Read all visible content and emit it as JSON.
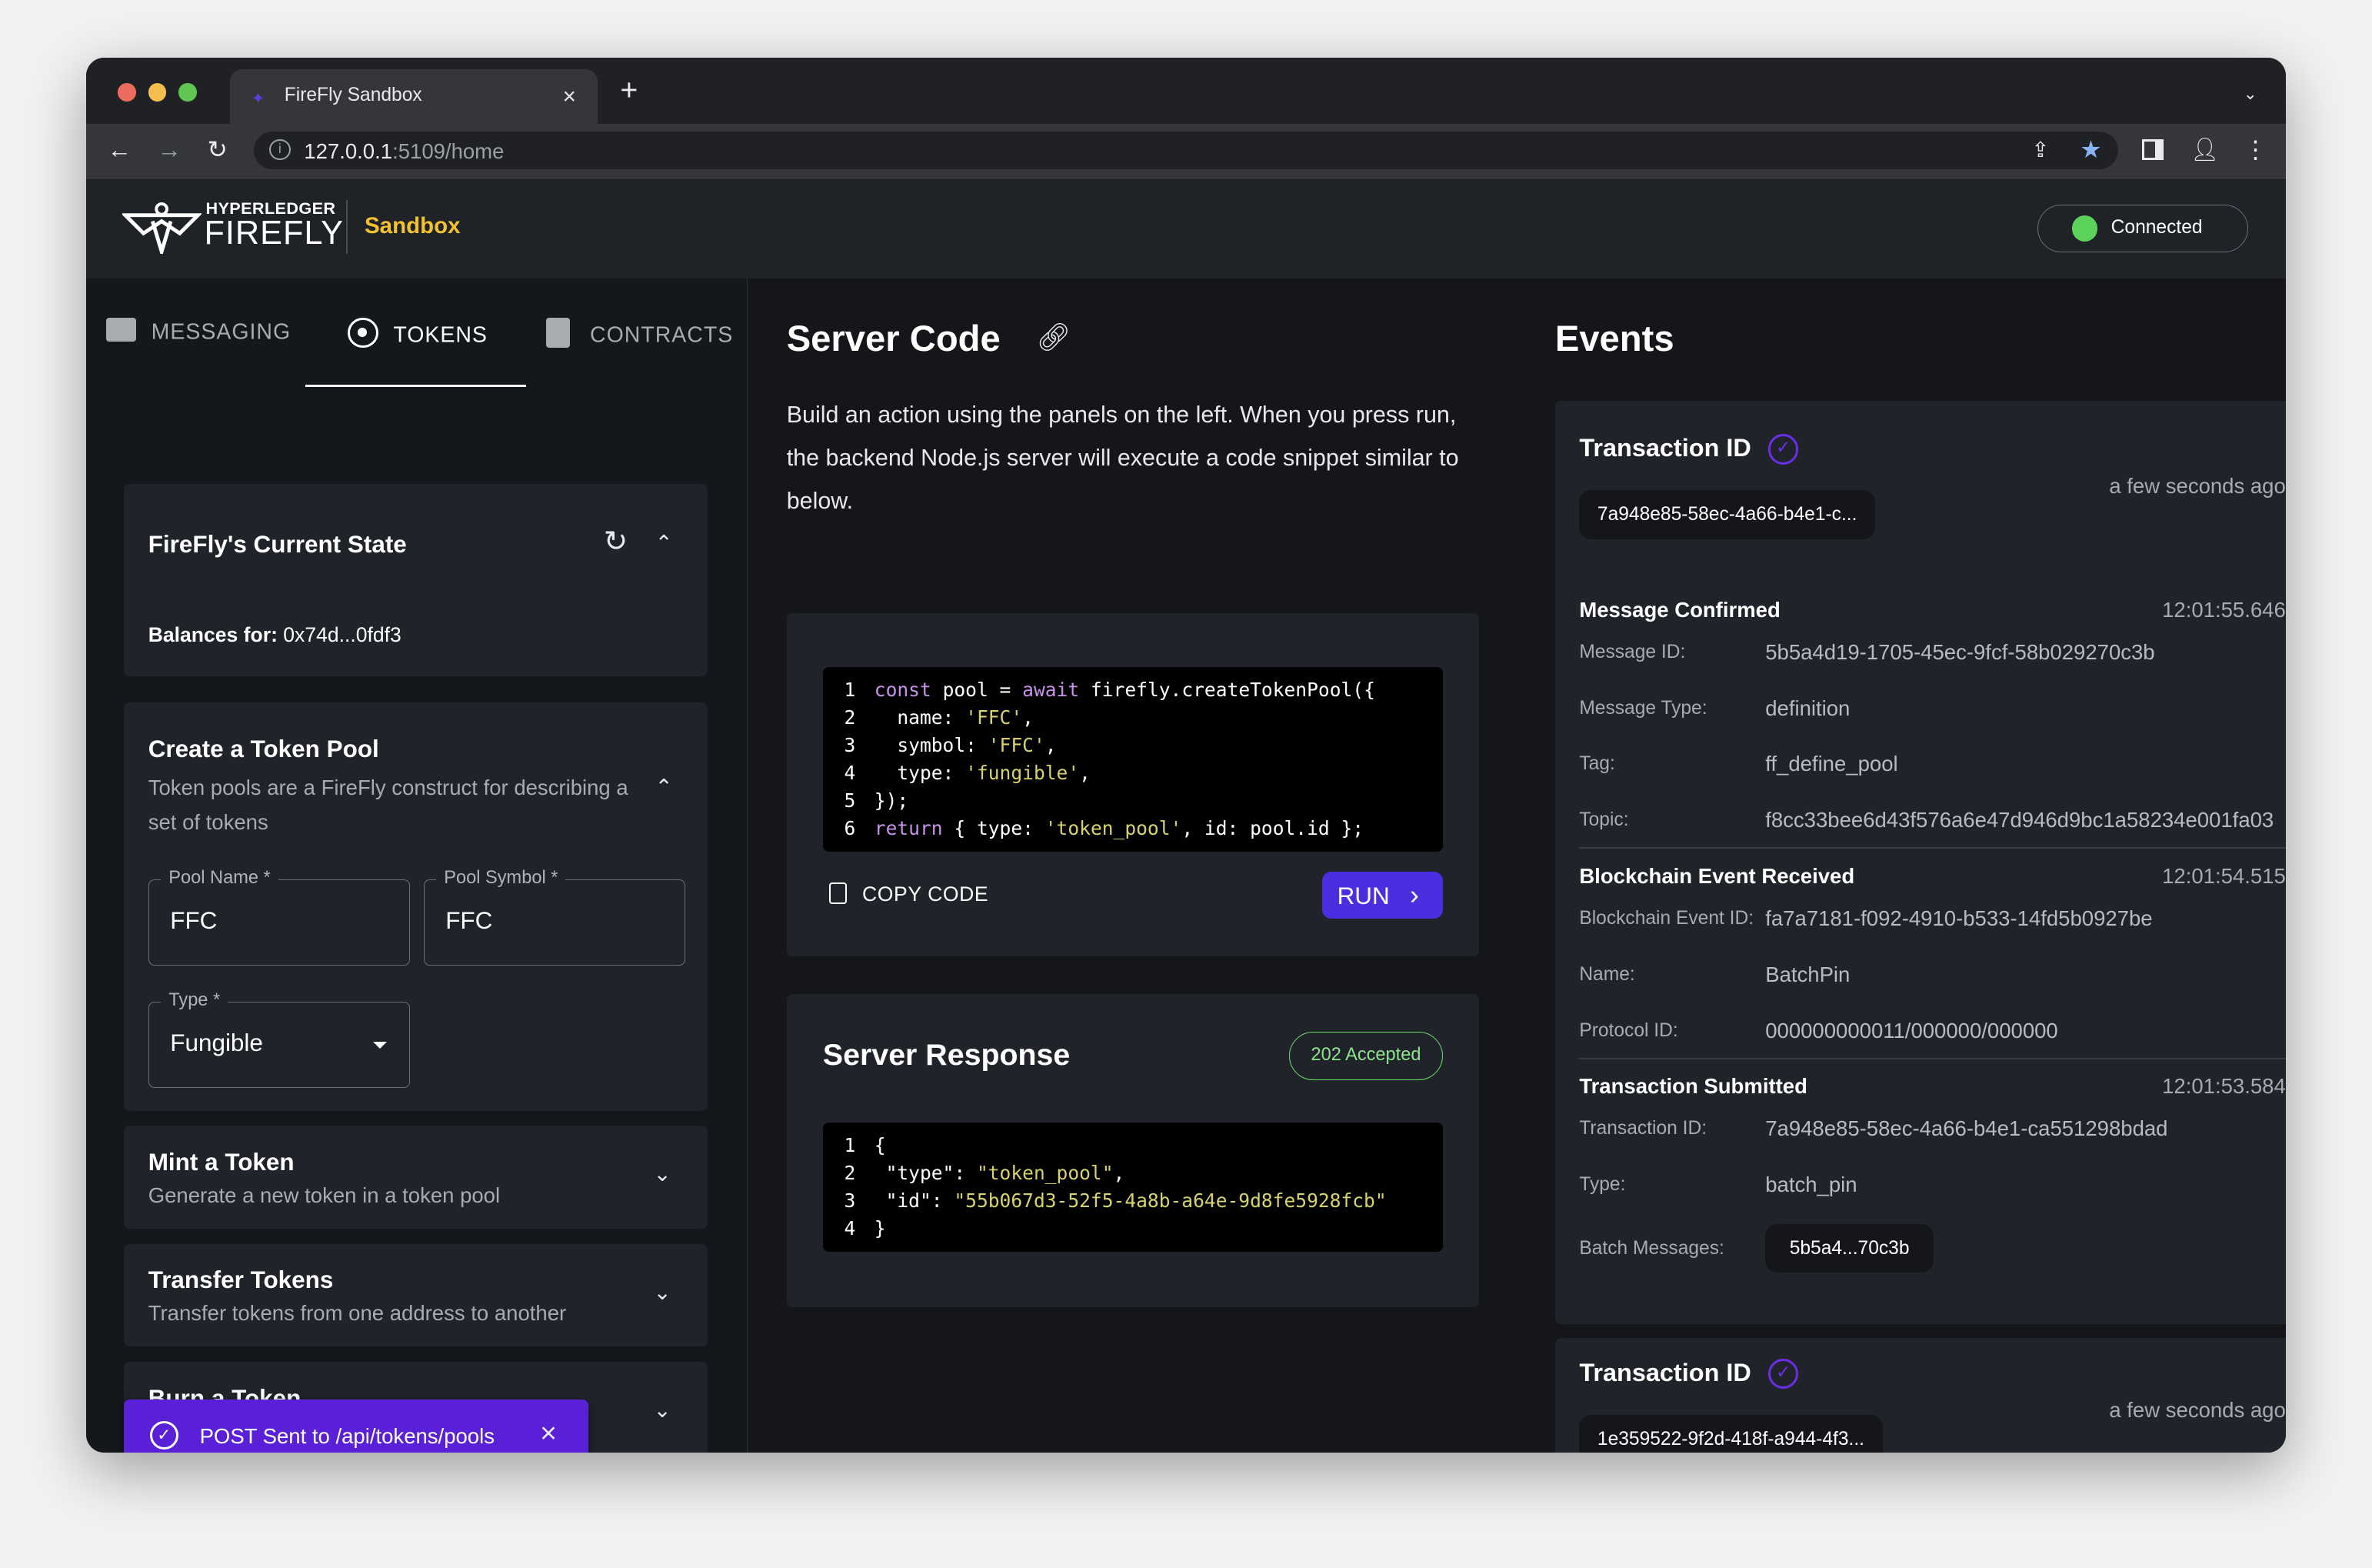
{
  "browser": {
    "tab_title": "FireFly Sandbox",
    "url_host": "127.0.0.1",
    "url_rest": ":5109/home"
  },
  "header": {
    "logo_top": "HYPERLEDGER",
    "logo_bottom": "FIREFLY",
    "app_name": "Sandbox",
    "status": "Connected",
    "colors": {
      "brand_yellow": "#f2c230",
      "connected_green": "#5bd35b",
      "accent_purple": "#4b2ee0"
    }
  },
  "left": {
    "tabs": [
      {
        "label": "MESSAGING",
        "icon": "message-icon"
      },
      {
        "label": "TOKENS",
        "icon": "radio-target-icon"
      },
      {
        "label": "CONTRACTS",
        "icon": "document-icon"
      }
    ],
    "active_tab": "TOKENS",
    "state_card": {
      "title": "FireFly's Current State",
      "balances_label": "Balances for:",
      "balances_value": "0x74d...0fdf3"
    },
    "create_pool": {
      "title": "Create a Token Pool",
      "description": "Token pools are a FireFly construct for describing a set of tokens",
      "pool_name_label": "Pool Name *",
      "pool_name_value": "FFC",
      "pool_symbol_label": "Pool Symbol *",
      "pool_symbol_value": "FFC",
      "type_label": "Type *",
      "type_value": "Fungible"
    },
    "mint": {
      "title": "Mint a Token",
      "description": "Generate a new token in a token pool"
    },
    "transfer": {
      "title": "Transfer Tokens",
      "description": "Transfer tokens from one address to another"
    },
    "burn": {
      "title": "Burn a Token"
    },
    "toast": "POST Sent to /api/tokens/pools"
  },
  "middle": {
    "server_code_title": "Server Code",
    "description": "Build an action using the panels on the left. When you press run, the backend Node.js server will execute a code snippet similar to below.",
    "code_lines": [
      "const pool = await firefly.createTokenPool({",
      "  name: 'FFC',",
      "  symbol: 'FFC',",
      "  type: 'fungible',",
      "});",
      "return { type: 'token_pool', id: pool.id };"
    ],
    "copy_label": "COPY CODE",
    "run_label": "RUN",
    "response_title": "Server Response",
    "response_status": "202 Accepted",
    "response_lines": [
      "{",
      " \"type\": \"token_pool\",",
      " \"id\": \"55b067d3-52f5-4a8b-a64e-9d8fe5928fcb\"",
      "}"
    ]
  },
  "events": {
    "title": "Events",
    "cards": [
      {
        "heading": "Transaction ID",
        "tx_short": "7a948e85-58ec-4a66-b4e1-c...",
        "age": "a few seconds ago",
        "events": [
          {
            "title": "Message Confirmed",
            "time": "12:01:55.646",
            "rows": [
              {
                "label": "Message ID:",
                "value": "5b5a4d19-1705-45ec-9fcf-58b029270c3b"
              },
              {
                "label": "Message Type:",
                "value": "definition"
              },
              {
                "label": "Tag:",
                "value": "ff_define_pool"
              },
              {
                "label": "Topic:",
                "value": "f8cc33bee6d43f576a6e47d946d9bc1a58234e001fa03"
              }
            ]
          },
          {
            "title": "Blockchain Event Received",
            "time": "12:01:54.515",
            "rows": [
              {
                "label": "Blockchain Event ID:",
                "value": "fa7a7181-f092-4910-b533-14fd5b0927be"
              },
              {
                "label": "Name:",
                "value": "BatchPin"
              },
              {
                "label": "Protocol ID:",
                "value": "000000000011/000000/000000"
              }
            ]
          },
          {
            "title": "Transaction Submitted",
            "time": "12:01:53.584",
            "rows": [
              {
                "label": "Transaction ID:",
                "value": "7a948e85-58ec-4a66-b4e1-ca551298bdad"
              },
              {
                "label": "Type:",
                "value": "batch_pin"
              },
              {
                "label": "Batch Messages:",
                "value": "5b5a4...70c3b"
              }
            ]
          }
        ]
      },
      {
        "heading": "Transaction ID",
        "tx_short": "1e359522-9f2d-418f-a944-4f3...",
        "age": "a few seconds ago"
      }
    ]
  }
}
